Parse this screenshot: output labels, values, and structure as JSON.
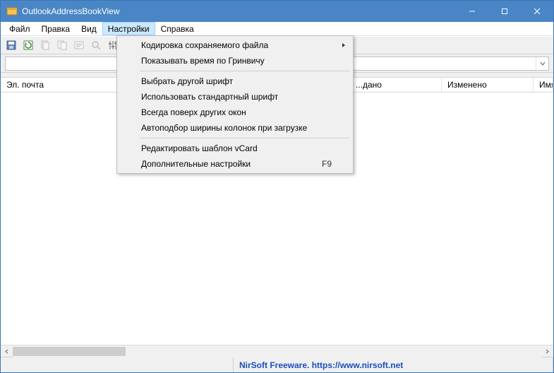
{
  "window": {
    "title": "OutlookAddressBookView"
  },
  "menubar": {
    "items": [
      "Файл",
      "Правка",
      "Вид",
      "Настройки",
      "Справка"
    ],
    "active_index": 3
  },
  "dropdown": {
    "groups": [
      [
        {
          "label": "Кодировка сохраняемого файла",
          "submenu": true
        },
        {
          "label": "Показывать время по Гринвичу"
        }
      ],
      [
        {
          "label": "Выбрать другой шрифт"
        },
        {
          "label": "Использовать стандартный шрифт"
        },
        {
          "label": "Всегда поверх других окон"
        },
        {
          "label": "Автоподбор ширины колонок при загрузке"
        }
      ],
      [
        {
          "label": "Редактировать шаблон vCard"
        },
        {
          "label": "Дополнительные настройки",
          "accel": "F9"
        }
      ]
    ]
  },
  "columns": {
    "email": "Эл. почта",
    "created": "...дано",
    "modified": "Изменено",
    "name": "Имя"
  },
  "statusbar": {
    "credit": "NirSoft Freeware. https://www.nirsoft.net"
  }
}
